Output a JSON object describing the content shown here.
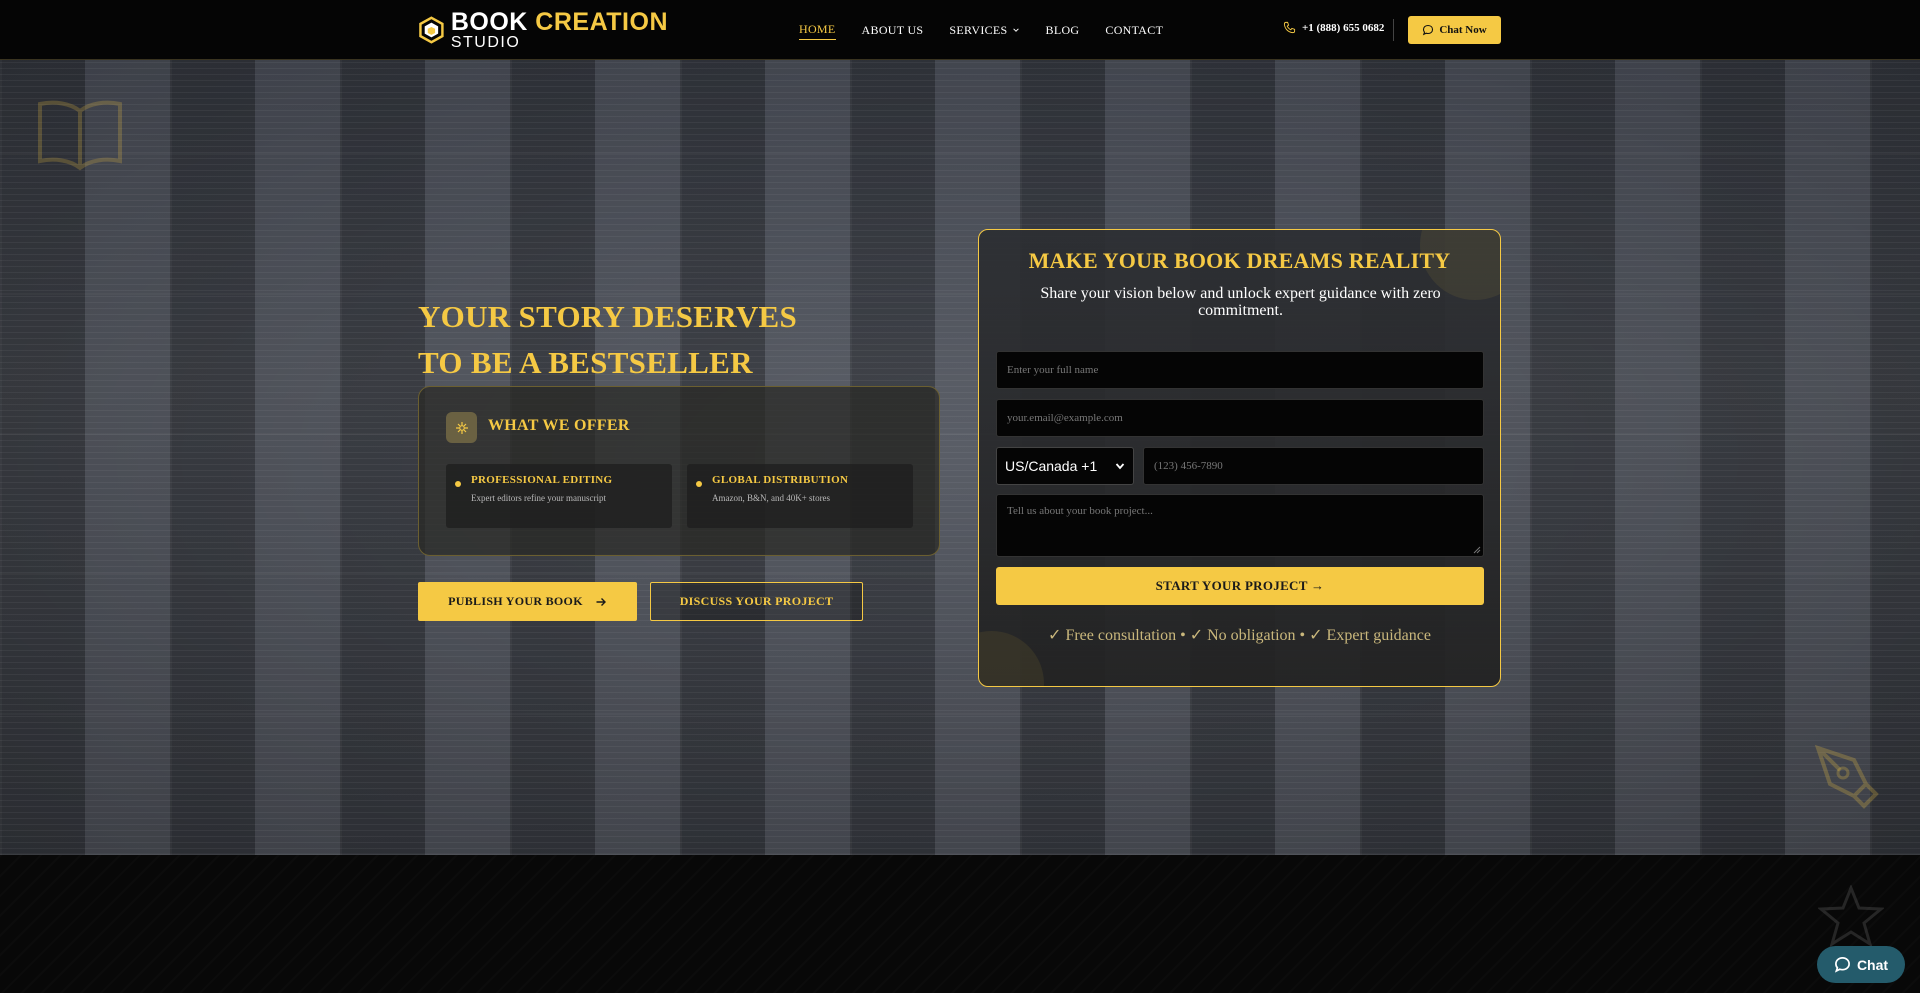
{
  "brand": {
    "name_part1": "BOOK",
    "name_part2": "CREATION",
    "name_part3": "STUDIO"
  },
  "nav": {
    "items": [
      {
        "label": "HOME",
        "active": true
      },
      {
        "label": "ABOUT US",
        "active": false
      },
      {
        "label": "SERVICES",
        "active": false,
        "has_dropdown": true
      },
      {
        "label": "BLOG",
        "active": false
      },
      {
        "label": "CONTACT",
        "active": false
      }
    ],
    "phone": "+1 (888) 655 0682",
    "chat_button": "Chat Now"
  },
  "hero": {
    "headline_line1": "YOUR STORY DESERVES",
    "headline_line2": "TO BE A BESTSELLER",
    "offer": {
      "title": "WHAT WE OFFER",
      "features": [
        {
          "title": "PROFESSIONAL EDITING",
          "desc": "Expert editors refine your manuscript"
        },
        {
          "title": "GLOBAL DISTRIBUTION",
          "desc": "Amazon, B&N, and 40K+ stores"
        }
      ]
    },
    "primary_button": "PUBLISH YOUR BOOK",
    "secondary_button": "DISCUSS YOUR PROJECT"
  },
  "form": {
    "title": "MAKE YOUR BOOK DREAMS REALITY",
    "subtitle": "Share your vision below and unlock expert guidance with zero commitment.",
    "name_placeholder": "Enter your full name",
    "email_placeholder": "your.email@example.com",
    "country_selected": "US/Canada +1",
    "phone_placeholder": "(123) 456-7890",
    "message_placeholder": "Tell us about your book project...",
    "submit_label": "START YOUR PROJECT →",
    "trust_line": "✓ Free consultation • ✓ No obligation • ✓ Expert guidance"
  },
  "chat_widget": {
    "label": "Chat"
  },
  "colors": {
    "accent": "#f5c944",
    "background": "#050505",
    "chat_widget": "#245b6b"
  }
}
